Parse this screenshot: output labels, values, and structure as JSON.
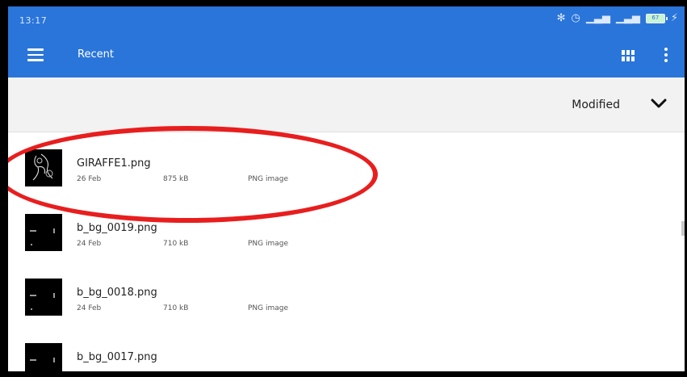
{
  "status_bar": {
    "time": "13:17",
    "battery_level": "67",
    "icons": [
      "bluetooth-icon",
      "alarm-icon",
      "signal-icon",
      "signal-icon-2",
      "battery-icon",
      "charging-icon"
    ]
  },
  "app_bar": {
    "title": "Recent"
  },
  "sort": {
    "label": "Modified"
  },
  "files": [
    {
      "name": "GIRAFFE1.png",
      "date": "26 Feb",
      "size": "875 kB",
      "type": "PNG image"
    },
    {
      "name": "b_bg_0019.png",
      "date": "24 Feb",
      "size": "710 kB",
      "type": "PNG image"
    },
    {
      "name": "b_bg_0018.png",
      "date": "24 Feb",
      "size": "710 kB",
      "type": "PNG image"
    },
    {
      "name": "b_bg_0017.png",
      "date": "",
      "size": "",
      "type": ""
    }
  ],
  "colors": {
    "app_blue": "#2a75d9",
    "annotation_red": "#e81e1e"
  }
}
